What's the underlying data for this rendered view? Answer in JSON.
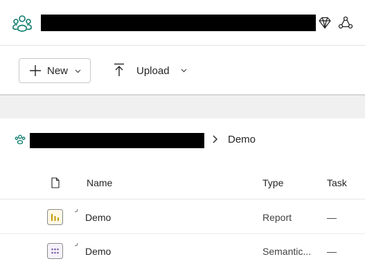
{
  "header": {
    "workspace_icon": "workspace-people-icon",
    "premium_icon": "diamond-icon",
    "network_icon": "network-share-icon"
  },
  "toolbar": {
    "new_label": "New",
    "upload_label": "Upload"
  },
  "breadcrumb": {
    "separator": ">",
    "current": "Demo"
  },
  "table": {
    "headers": {
      "name": "Name",
      "type": "Type",
      "task": "Task"
    },
    "rows": [
      {
        "icon": "report-icon",
        "name": "Demo",
        "type": "Report",
        "task": "—"
      },
      {
        "icon": "semantic-model-icon",
        "name": "Demo",
        "type": "Semantic...",
        "task": "—"
      }
    ]
  },
  "colors": {
    "accent_teal": "#107c6e",
    "report_yellow": "#c19c00",
    "semantic_purple": "#7a5fa6",
    "band_gray": "#f0f0f0"
  }
}
